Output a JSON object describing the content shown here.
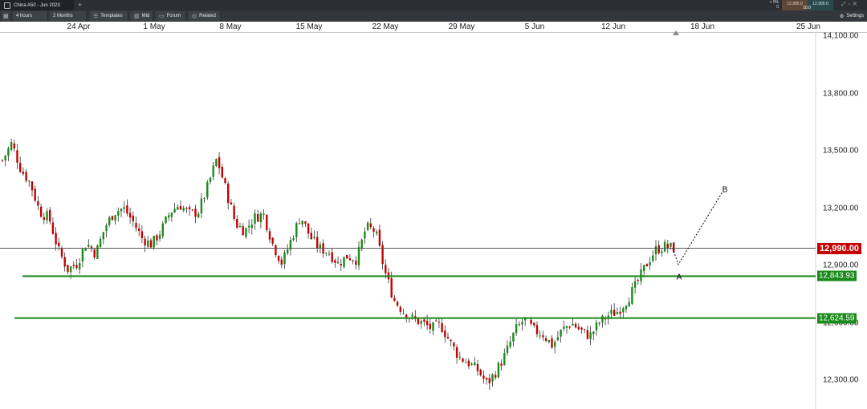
{
  "app": {
    "instrument_tab": "China A50 - Jun 2023",
    "change_pct": "+ 0%",
    "change_val": "0",
    "bid": "12,985.0",
    "ask": "12,995.0",
    "spread": "10.0"
  },
  "toolbar": {
    "interval": "4 hours",
    "range": "2 Months",
    "templates": "Templates",
    "price_type": "Mid",
    "forum": "Forum",
    "related": "Related",
    "settings": "Settings"
  },
  "colors": {
    "up": "#1a8a1a",
    "down": "#c40000",
    "support": "#1a8a1a",
    "current": "#c40000"
  },
  "chart_data": {
    "type": "candlestick",
    "x_tick_labels": [
      "24 Apr",
      "1 May",
      "8 May",
      "15 May",
      "22 May",
      "29 May",
      "5 Jun",
      "12 Jun",
      "18 Jun",
      "25 Jun"
    ],
    "y_tick_labels": [
      "14,100.00",
      "13,800.00",
      "13,500.00",
      "13,200.00",
      "12,900.00",
      "12,600.00",
      "12,300.00"
    ],
    "y_ticks": [
      14100,
      13800,
      13500,
      13200,
      12900,
      12600,
      12300
    ],
    "ylim": [
      12220,
      14140
    ],
    "current_price": {
      "value": 12990,
      "label": "12,990.00"
    },
    "levels": [
      {
        "value": 12843.93,
        "label": "12,843.93"
      },
      {
        "value": 12624.59,
        "label": "12,624.59"
      }
    ],
    "wave_labels": [
      {
        "text": "A",
        "value": 12835
      },
      {
        "text": "B",
        "value": 13295
      }
    ],
    "close_path": [
      13450,
      13540,
      13400,
      13330,
      13180,
      13150,
      12980,
      12880,
      12910,
      13020,
      12960,
      13100,
      13180,
      13200,
      13130,
      13040,
      13010,
      13080,
      13180,
      13220,
      13170,
      13180,
      13310,
      13460,
      13290,
      13120,
      13080,
      13150,
      13170,
      13010,
      12910,
      13040,
      13160,
      13050,
      12990,
      12970,
      12910,
      12950,
      12930,
      13100,
      13080,
      12870,
      12720,
      12660,
      12620,
      12600,
      12570,
      12590,
      12500,
      12420,
      12390,
      12350,
      12280,
      12350,
      12440,
      12560,
      12620,
      12560,
      12540,
      12480,
      12560,
      12600,
      12560,
      12530,
      12600,
      12640,
      12660,
      12720,
      12800,
      12900,
      12980,
      13000,
      12990
    ]
  }
}
